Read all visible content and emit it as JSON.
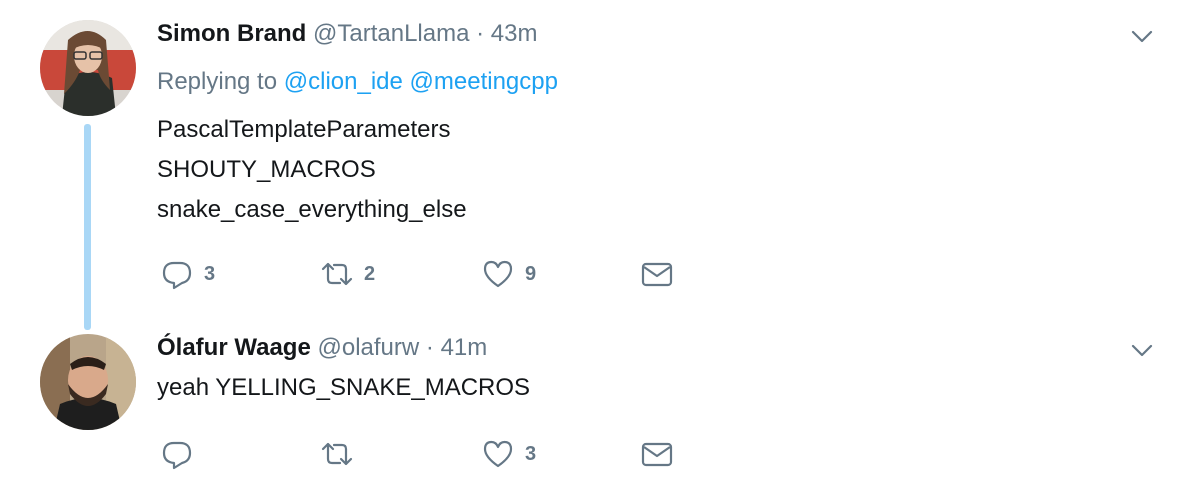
{
  "tweets": [
    {
      "name": "Simon Brand",
      "handle": "@TartanLlama",
      "separator": "·",
      "time": "43m",
      "replying_prefix": "Replying to",
      "mentions": [
        "@clion_ide",
        "@meetingcpp"
      ],
      "lines": [
        "PascalTemplateParameters",
        "SHOUTY_MACROS",
        "snake_case_everything_else"
      ],
      "actions": {
        "replies": "3",
        "retweets": "2",
        "likes": "9"
      },
      "avatar_icon": "user-avatar-photo"
    },
    {
      "name": "Ólafur Waage",
      "handle": "@olafurw",
      "separator": "·",
      "time": "41m",
      "lines": [
        "yeah YELLING_SNAKE_MACROS"
      ],
      "actions": {
        "replies": "",
        "retweets": "",
        "likes": "3"
      },
      "avatar_icon": "user-avatar-photo"
    }
  ],
  "icons": {
    "reply": "reply-icon",
    "retweet": "retweet-icon",
    "like": "heart-icon",
    "dm": "envelope-icon",
    "menu": "chevron-down-icon"
  },
  "colors": {
    "text": "#14171a",
    "secondary": "#657786",
    "link": "#1da1f2",
    "thread_line": "#a9d7f6"
  }
}
